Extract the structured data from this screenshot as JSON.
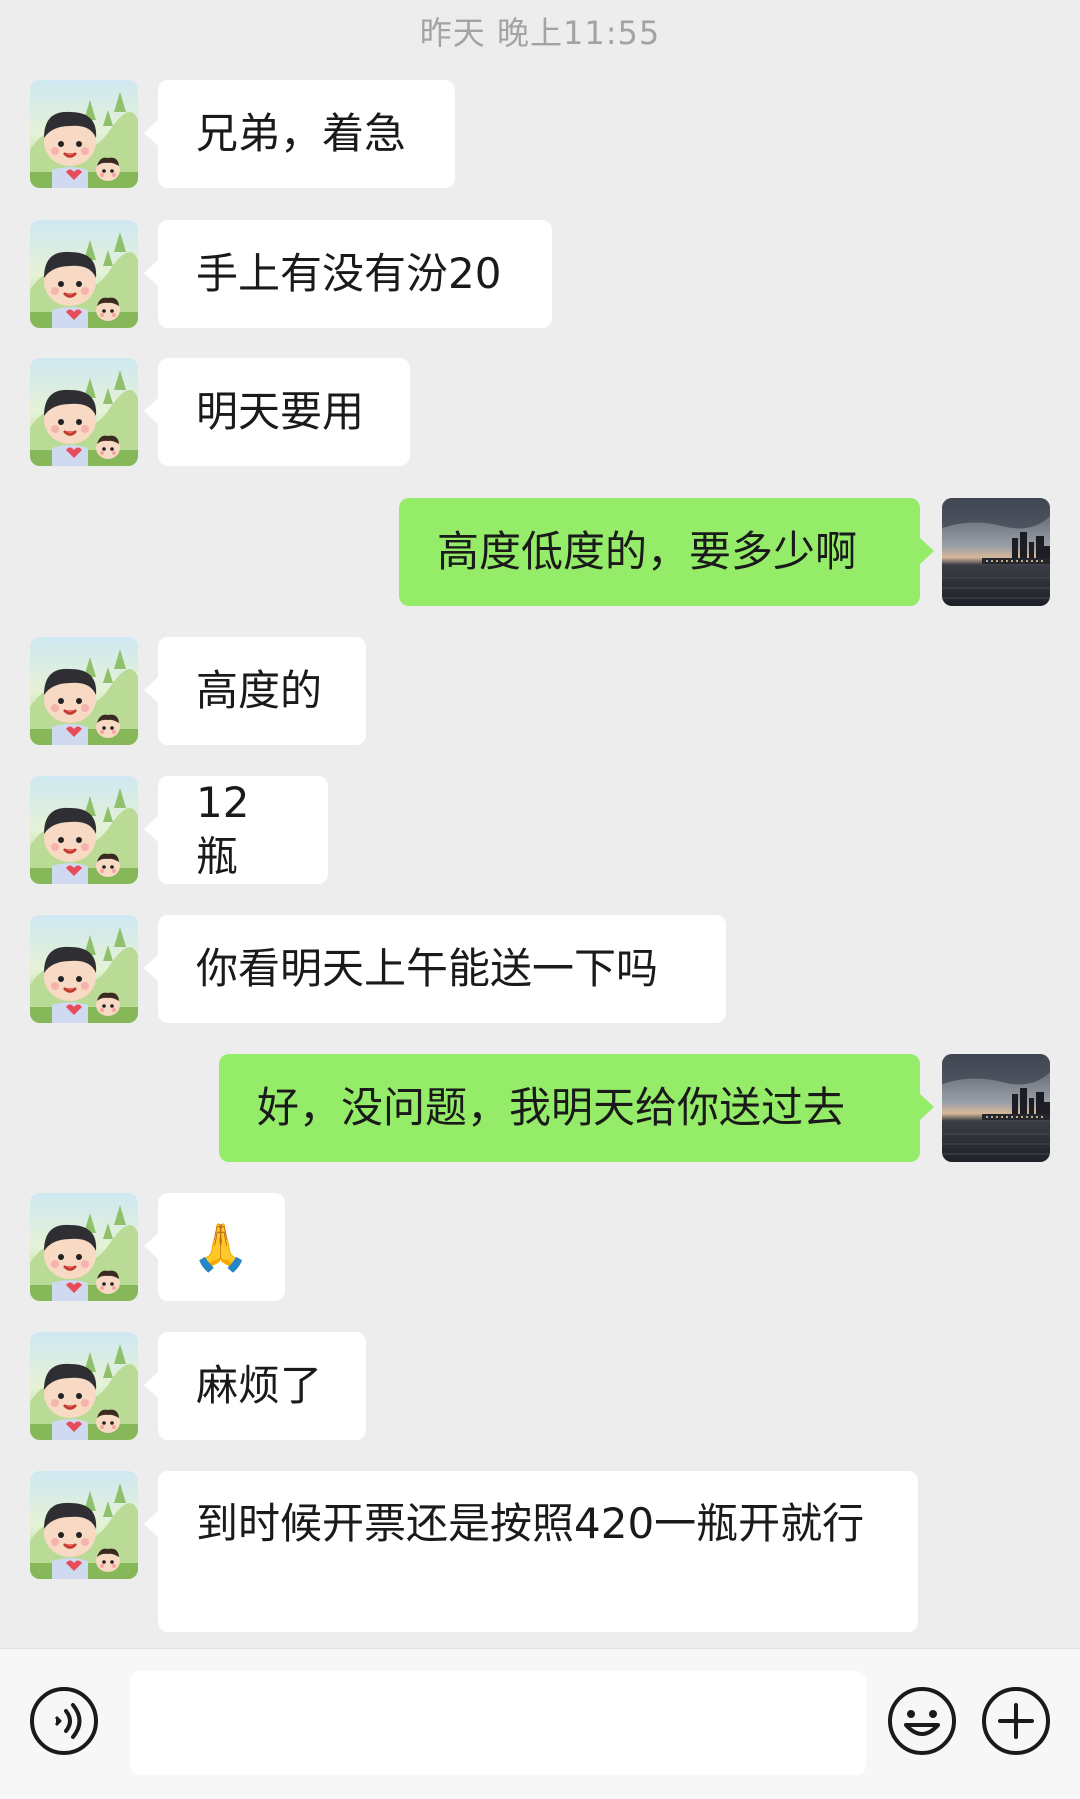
{
  "timestamp": "昨天 晚上11:55",
  "messages": [
    {
      "side": "in",
      "text": "兄弟，着急"
    },
    {
      "side": "in",
      "text": "手上有没有汾20"
    },
    {
      "side": "in",
      "text": "明天要用"
    },
    {
      "side": "out",
      "text": "高度低度的，要多少啊"
    },
    {
      "side": "in",
      "text": "高度的"
    },
    {
      "side": "in",
      "text": "12瓶"
    },
    {
      "side": "in",
      "text": "你看明天上午能送一下吗"
    },
    {
      "side": "out",
      "text": "好，没问题，我明天给你送过去"
    },
    {
      "side": "in",
      "text": "🙏",
      "emoji": "pray-hands-icon"
    },
    {
      "side": "in",
      "text": "麻烦了"
    },
    {
      "side": "in",
      "text": "到时候开票还是按照420一瓶开就行"
    }
  ],
  "input": {
    "value": "",
    "placeholder": ""
  },
  "icons": {
    "voice": "voice-icon",
    "emoji": "emoji-icon",
    "plus": "plus-icon"
  },
  "colors": {
    "background": "#ededed",
    "incoming_bubble": "#ffffff",
    "outgoing_bubble": "#95ec69",
    "timestamp": "#a3a3a3"
  }
}
